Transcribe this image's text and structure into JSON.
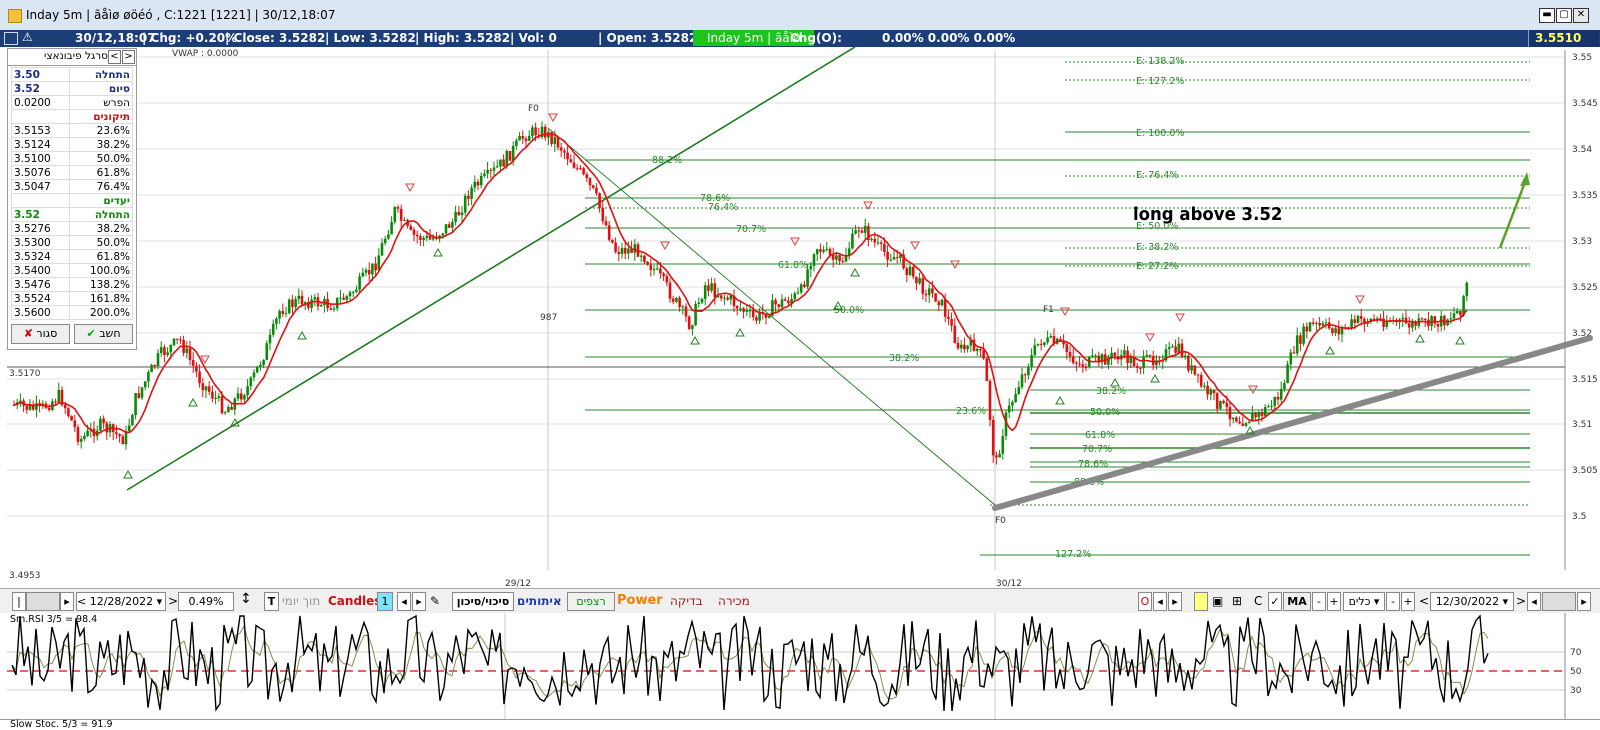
{
  "window": {
    "title": "Inday 5m | ãåìø øöéó , C:1221 [1221] | 30/12,18:07",
    "minimize": "▬",
    "maximize": "▢",
    "close": "✕"
  },
  "infobar": {
    "datetime": "30/12,18:07",
    "chg": "| Chg: +0.20%",
    "close": "| Close: 3.5282",
    "low": "| Low: 3.5282",
    "high": "| High: 3.5282",
    "vol": "| Vol: 0",
    "open": "| Open: 3.5282",
    "tab": "Inday 5m | ãåìø",
    "chgo": "Chg(O):",
    "pcts": "0.00% 0.00% 0.00%",
    "price": "3.5510"
  },
  "fib": {
    "title": "סרגל פיבונאצי",
    "rows": [
      {
        "v": "3.50",
        "l": "התחלה",
        "kind": "head"
      },
      {
        "v": "3.52",
        "l": "סיום",
        "kind": "head"
      },
      {
        "v": "0.0200",
        "l": "הפרש",
        "kind": "plain"
      },
      {
        "v": "",
        "l": "תיקונים",
        "kind": "section"
      },
      {
        "v": "3.5153",
        "l": "23.6%",
        "kind": "plain"
      },
      {
        "v": "3.5124",
        "l": "38.2%",
        "kind": "plain"
      },
      {
        "v": "3.5100",
        "l": "50.0%",
        "kind": "plain"
      },
      {
        "v": "3.5076",
        "l": "61.8%",
        "kind": "plain"
      },
      {
        "v": "3.5047",
        "l": "76.4%",
        "kind": "plain"
      },
      {
        "v": "",
        "l": "יעדים",
        "kind": "section2"
      },
      {
        "v": "3.52",
        "l": "התחלה",
        "kind": "head2"
      },
      {
        "v": "3.5276",
        "l": "38.2%",
        "kind": "plain"
      },
      {
        "v": "3.5300",
        "l": "50.0%",
        "kind": "plain"
      },
      {
        "v": "3.5324",
        "l": "61.8%",
        "kind": "plain"
      },
      {
        "v": "3.5400",
        "l": "100.0%",
        "kind": "plain"
      },
      {
        "v": "3.5476",
        "l": "138.2%",
        "kind": "plain"
      },
      {
        "v": "3.5524",
        "l": "161.8%",
        "kind": "plain"
      },
      {
        "v": "3.5600",
        "l": "200.0%",
        "kind": "plain"
      }
    ],
    "close_label": "סגור",
    "calc_label": "חשב"
  },
  "chart": {
    "vwap": "VWAP : 0.0000",
    "left_price": "3.5170",
    "left_bottom": "3.4953",
    "label_987": "987",
    "date1": "29/12",
    "date2": "30/12",
    "note": "long above 3.52",
    "f0": "F0",
    "f1": "F1",
    "yticks": [
      {
        "v": "3.55",
        "y": 57
      },
      {
        "v": "3.545",
        "y": 103
      },
      {
        "v": "3.54",
        "y": 149
      },
      {
        "v": "3.535",
        "y": 195
      },
      {
        "v": "3.53",
        "y": 241
      },
      {
        "v": "3.525",
        "y": 287
      },
      {
        "v": "3.52",
        "y": 333
      },
      {
        "v": "3.515",
        "y": 379
      },
      {
        "v": "3.51",
        "y": 424
      },
      {
        "v": "3.505",
        "y": 470
      },
      {
        "v": "3.5",
        "y": 516
      }
    ],
    "fib_labels": [
      {
        "t": "E: 138.2%",
        "x": 1136,
        "y": 64
      },
      {
        "t": "E: 127.2%",
        "x": 1136,
        "y": 84
      },
      {
        "t": "E: 100.0%",
        "x": 1136,
        "y": 136
      },
      {
        "t": "E: 76.4%",
        "x": 1136,
        "y": 178
      },
      {
        "t": "E: 50.0%",
        "x": 1136,
        "y": 229
      },
      {
        "t": "E: 38.2%",
        "x": 1136,
        "y": 250
      },
      {
        "t": "E: 27.2%",
        "x": 1136,
        "y": 269
      },
      {
        "t": "88.2%",
        "x": 652,
        "y": 163
      },
      {
        "t": "78.6%",
        "x": 700,
        "y": 201
      },
      {
        "t": "76.4%",
        "x": 708,
        "y": 210
      },
      {
        "t": "70.7%",
        "x": 736,
        "y": 232
      },
      {
        "t": "61.8%",
        "x": 778,
        "y": 268
      },
      {
        "t": "50.0%",
        "x": 834,
        "y": 313
      },
      {
        "t": "38.2%",
        "x": 889,
        "y": 361
      },
      {
        "t": "23.6%",
        "x": 956,
        "y": 414
      },
      {
        "t": "38.2%",
        "x": 1096,
        "y": 394
      },
      {
        "t": "50.0%",
        "x": 1090,
        "y": 415
      },
      {
        "t": "61.8%",
        "x": 1085,
        "y": 438
      },
      {
        "t": "70.7%",
        "x": 1082,
        "y": 452
      },
      {
        "t": "78.6%",
        "x": 1078,
        "y": 467
      },
      {
        "t": "88.6%",
        "x": 1074,
        "y": 485
      },
      {
        "t": "127.2%",
        "x": 1055,
        "y": 557
      }
    ]
  },
  "toolbar": {
    "date_left": "12/28/2022",
    "pct": "0.49%",
    "t": "T",
    "intraday": "תוך יומי",
    "candles": "Candles",
    "candles_n": "1",
    "risk": "סיכוי/סיכון",
    "signals": "איתותים",
    "continuous": "רצפים",
    "power": "Power",
    "check": "בדיקה",
    "sell": "מכירה",
    "o": "O",
    "c": "C",
    "ma": "MA",
    "tools": "כלים",
    "date_right": "12/30/2022"
  },
  "rsi": {
    "label": "Sm.RSI 3/5 = 98.4",
    "l70": "70",
    "l50": "50",
    "l30": "30"
  },
  "stoch": {
    "label": "Slow Stoc. 5/3 = 91.9"
  },
  "colors": {
    "up": "#0a8a0a",
    "down": "#e01010",
    "ma": "#e01010",
    "trend": "#1f7a1f",
    "fibline": "#2a8a2a",
    "support": "#888888"
  }
}
